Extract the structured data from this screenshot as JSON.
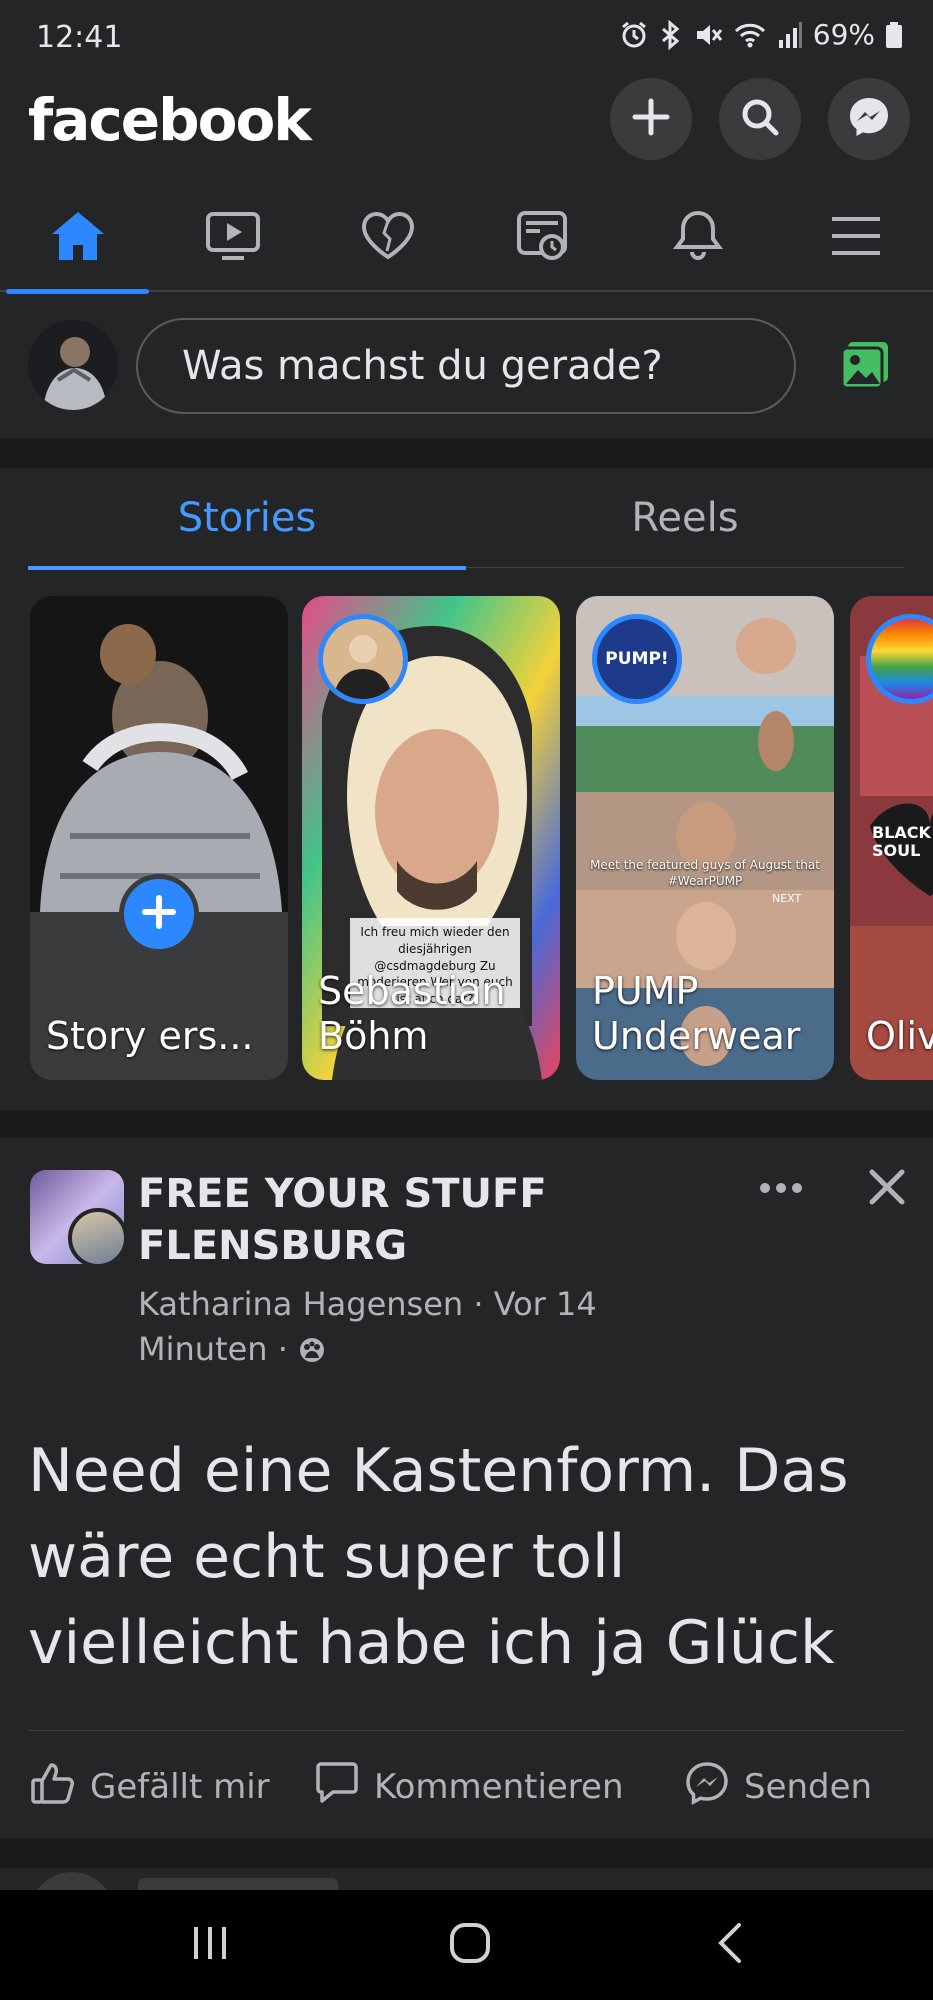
{
  "status_bar": {
    "time": "12:41",
    "battery": "69%",
    "icons": [
      "alarm-icon",
      "bluetooth-icon",
      "mute-icon",
      "wifi-icon",
      "signal-icon",
      "battery-icon"
    ]
  },
  "header": {
    "logo": "facebook",
    "buttons": [
      "add-icon",
      "search-icon",
      "messenger-icon"
    ]
  },
  "nav": {
    "tabs": [
      "home-icon",
      "video-icon",
      "dating-icon",
      "news-icon",
      "notifications-icon",
      "menu-icon"
    ],
    "active": 0,
    "accent": "#2d88ff"
  },
  "composer": {
    "placeholder": "Was machst du gerade?",
    "photo_icon_color": "#45bd62"
  },
  "stories": {
    "tabs": [
      "Stories",
      "Reels"
    ],
    "active_tab": 0,
    "cards": [
      {
        "name": "Story ers..."
      },
      {
        "name": "Sebastian Böhm",
        "overlay_text": "Ich freu mich wieder den diesjährigen @csdmagdeburg Zu moderieren Wer von euch ist auch dar?"
      },
      {
        "name": "PUMP Underwear",
        "avatar_label": "PUMP!",
        "overlay_text": "Meet the featured guys of August that #WearPUMP",
        "next_label": "NEXT"
      },
      {
        "name": "Oliv Jor",
        "overlay_text": "BLACK SOUL"
      }
    ]
  },
  "post": {
    "group_name": "FREE YOUR STUFF FLENSBURG",
    "author": "Katharina Hagensen",
    "time": "Vor 14 Minuten",
    "text": "Need eine  Kastenform. Das wäre echt super  toll vielleicht  habe ich ja Glück",
    "actions": {
      "like": "Gefällt mir",
      "comment": "Kommentieren",
      "send": "Senden"
    }
  },
  "system_nav": [
    "recents-icon",
    "home-button-icon",
    "back-icon"
  ]
}
